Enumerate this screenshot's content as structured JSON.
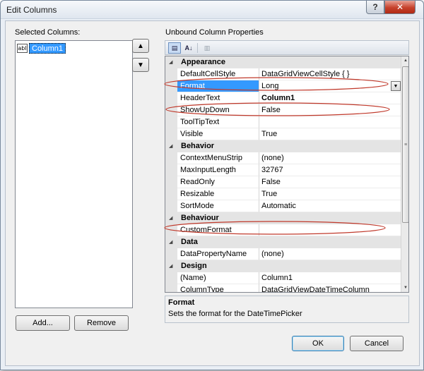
{
  "window": {
    "title": "Edit Columns",
    "help_glyph": "?",
    "close_glyph": "✕"
  },
  "left_panel": {
    "heading": "Selected Columns:",
    "items": [
      {
        "icon": "text-column-icon",
        "icon_text": "abl",
        "label": "Column1",
        "selected": true
      }
    ],
    "add_label": "Add...",
    "remove_label": "Remove",
    "move_up_glyph": "▲",
    "move_down_glyph": "▼"
  },
  "right_panel": {
    "heading": "Unbound Column Properties",
    "toolbar": {
      "categorized_glyph": "▤",
      "alphabetical_glyph": "A↓",
      "property_pages_glyph": "▥"
    },
    "grid": {
      "rows": [
        {
          "type": "category",
          "name": "Appearance"
        },
        {
          "type": "prop",
          "name": "DefaultCellStyle",
          "value": "DataGridViewCellStyle { }"
        },
        {
          "type": "prop",
          "name": "Format",
          "value": "Long",
          "selected": true,
          "dropdown": true,
          "highlighted": true
        },
        {
          "type": "prop",
          "name": "HeaderText",
          "value": "Column1",
          "bold": true
        },
        {
          "type": "prop",
          "name": "ShowUpDown",
          "value": "False",
          "highlighted": true
        },
        {
          "type": "prop",
          "name": "ToolTipText",
          "value": ""
        },
        {
          "type": "prop",
          "name": "Visible",
          "value": "True"
        },
        {
          "type": "category",
          "name": "Behavior"
        },
        {
          "type": "prop",
          "name": "ContextMenuStrip",
          "value": "(none)"
        },
        {
          "type": "prop",
          "name": "MaxInputLength",
          "value": "32767"
        },
        {
          "type": "prop",
          "name": "ReadOnly",
          "value": "False"
        },
        {
          "type": "prop",
          "name": "Resizable",
          "value": "True"
        },
        {
          "type": "prop",
          "name": "SortMode",
          "value": "Automatic"
        },
        {
          "type": "category",
          "name": "Behaviour"
        },
        {
          "type": "prop",
          "name": "CustomFormat",
          "value": "",
          "highlighted": true
        },
        {
          "type": "category",
          "name": "Data"
        },
        {
          "type": "prop",
          "name": "DataPropertyName",
          "value": "(none)"
        },
        {
          "type": "category",
          "name": "Design"
        },
        {
          "type": "prop",
          "name": "(Name)",
          "value": "Column1"
        },
        {
          "type": "prop",
          "name": "ColumnType",
          "value": "DataGridViewDateTimeColumn"
        }
      ],
      "collapse_glyph": "◢",
      "dropdown_glyph": "▼"
    },
    "description": {
      "title": "Format",
      "text": "Sets the format for the DateTimePicker"
    }
  },
  "footer": {
    "ok_label": "OK",
    "cancel_label": "Cancel"
  },
  "colors": {
    "selection": "#3399ff",
    "annotation_ellipse": "#c0392b",
    "category_band": "#e4e4e4"
  }
}
